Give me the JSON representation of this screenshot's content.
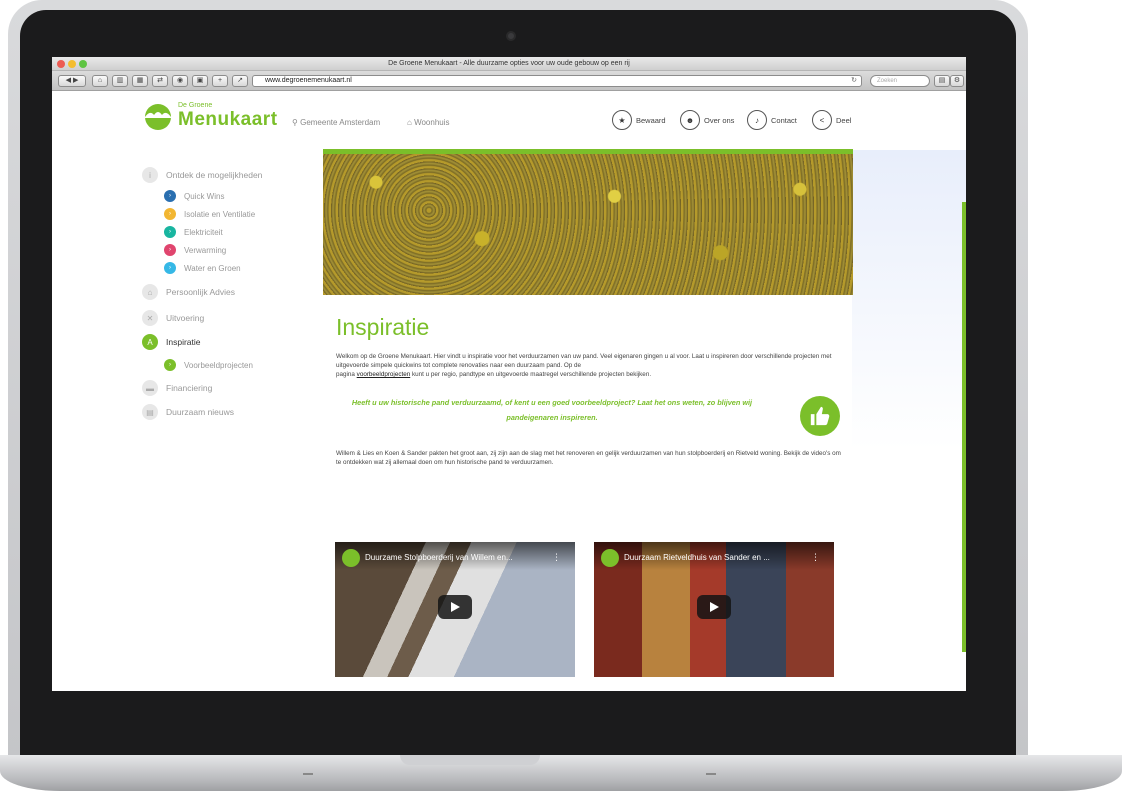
{
  "browser": {
    "window_title": "De Groene Menukaart - Alle duurzame opties voor uw oude gebouw op een rij",
    "url": "www.degroenemenukaart.nl",
    "search_placeholder": "Zoeken"
  },
  "header": {
    "logo_small": "De Groene",
    "logo_big": "Menukaart",
    "location": "Gemeente Amsterdam",
    "building_type": "Woonhuis",
    "actions": [
      {
        "label": "Bewaard",
        "icon": "star-icon"
      },
      {
        "label": "Over ons",
        "icon": "users-icon"
      },
      {
        "label": "Contact",
        "icon": "phone-icon"
      },
      {
        "label": "Deel",
        "icon": "share-icon"
      }
    ]
  },
  "sidebar": {
    "items": [
      {
        "label": "Ontdek de mogelijkheden",
        "badge": "i"
      },
      {
        "label": "Persoonlijk Advies",
        "badge": "⌂"
      },
      {
        "label": "Uitvoering",
        "badge": "✕"
      },
      {
        "label": "Inspiratie",
        "badge": "A"
      },
      {
        "label": "Financiering",
        "badge": "▬"
      },
      {
        "label": "Duurzaam nieuws",
        "badge": "▤"
      }
    ],
    "subitems": [
      {
        "label": "Quick Wins",
        "color": "#2a6fb0"
      },
      {
        "label": "Isolatie en Ventilatie",
        "color": "#f2b632"
      },
      {
        "label": "Elektriciteit",
        "color": "#19b5a0"
      },
      {
        "label": "Verwarming",
        "color": "#e0456e"
      },
      {
        "label": "Water en Groen",
        "color": "#36b8e6"
      }
    ],
    "inspiratie_sub": {
      "label": "Voorbeeldprojecten",
      "color": "#7bbf2a"
    }
  },
  "content": {
    "title": "Inspiratie",
    "intro_1": "Welkom op de Groene Menukaart. Hier vindt u inspiratie voor het verduurzamen van uw pand. Veel eigenaren gingen u al voor. Laat u inspireren door verschillende projecten met uitgevoerde simpele quickwins tot complete renovaties naar een duurzaam pand. Op de",
    "intro_2a": "pagina ",
    "intro_link": "voorbeeldprojecten",
    "intro_2b": " kunt u per regio, pandtype en uitgevoerde maatregel verschillende projecten bekijken.",
    "quote": "Heeft u uw historische pand verduurzaamd, of kent u een goed voorbeeldproject? Laat het ons weten, zo blijven wij pandeigenaren inspireren.",
    "body": "Willem & Lies en Koen & Sander pakten het groot aan, zij zijn aan de slag met het renoveren en gelijk verduurzamen van hun stolpboerderij en Rietveld woning. Bekijk de video's om te ontdekken wat zij allemaal doen om hun historische pand te verduurzamen."
  },
  "videos": [
    {
      "title": "Duurzame Stolpboerderij van Willem en..."
    },
    {
      "title": "Duurzaam Rietveldhuis van Sander en ..."
    }
  ],
  "colors": {
    "accent": "#7bbf2a"
  }
}
